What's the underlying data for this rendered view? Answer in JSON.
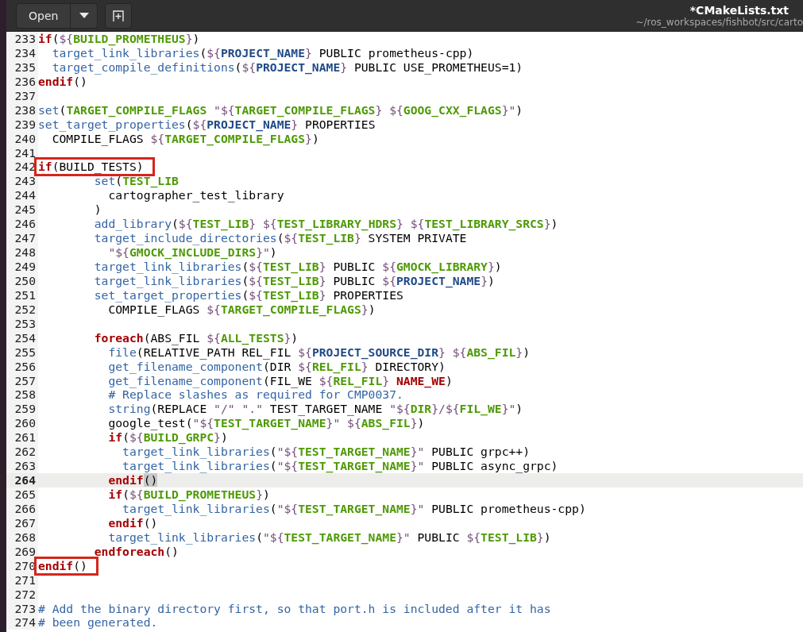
{
  "header": {
    "open_button": "Open",
    "title": "*CMakeLists.txt",
    "subtitle": "~/ros_workspaces/fishbot/src/carto"
  },
  "lines": [
    {
      "number": "233",
      "current": false,
      "boxed": false,
      "tokens": [
        {
          "kind": "kw",
          "text": "if"
        },
        {
          "kind": "txt",
          "text": "("
        },
        {
          "kind": "sym",
          "text": "${"
        },
        {
          "kind": "var",
          "text": "BUILD_PROMETHEUS"
        },
        {
          "kind": "sym",
          "text": "}"
        },
        {
          "kind": "txt",
          "text": ")"
        }
      ]
    },
    {
      "number": "234",
      "current": false,
      "boxed": false,
      "tokens": [
        {
          "kind": "fn",
          "text": "  target_link_libraries"
        },
        {
          "kind": "txt",
          "text": "("
        },
        {
          "kind": "sym",
          "text": "${"
        },
        {
          "kind": "pvar",
          "text": "PROJECT_NAME"
        },
        {
          "kind": "sym",
          "text": "}"
        },
        {
          "kind": "txt",
          "text": " PUBLIC prometheus-cpp)"
        }
      ]
    },
    {
      "number": "235",
      "current": false,
      "boxed": false,
      "tokens": [
        {
          "kind": "fn",
          "text": "  target_compile_definitions"
        },
        {
          "kind": "txt",
          "text": "("
        },
        {
          "kind": "sym",
          "text": "${"
        },
        {
          "kind": "pvar",
          "text": "PROJECT_NAME"
        },
        {
          "kind": "sym",
          "text": "}"
        },
        {
          "kind": "txt",
          "text": " PUBLIC USE_PROMETHEUS=1)"
        }
      ]
    },
    {
      "number": "236",
      "current": false,
      "boxed": false,
      "tokens": [
        {
          "kind": "kw",
          "text": "endif"
        },
        {
          "kind": "txt",
          "text": "()"
        }
      ]
    },
    {
      "number": "237",
      "current": false,
      "boxed": false
    },
    {
      "number": "238",
      "current": false,
      "boxed": false,
      "tokens": [
        {
          "kind": "fn",
          "text": "set"
        },
        {
          "kind": "txt",
          "text": "("
        },
        {
          "kind": "var",
          "text": "TARGET_COMPILE_FLAGS"
        },
        {
          "kind": "sym",
          "text": " \"${"
        },
        {
          "kind": "var",
          "text": "TARGET_COMPILE_FLAGS"
        },
        {
          "kind": "sym",
          "text": "} ${"
        },
        {
          "kind": "var",
          "text": "GOOG_CXX_FLAGS"
        },
        {
          "kind": "sym",
          "text": "}\""
        },
        {
          "kind": "txt",
          "text": ")"
        }
      ]
    },
    {
      "number": "239",
      "current": false,
      "boxed": false,
      "tokens": [
        {
          "kind": "fn",
          "text": "set_target_properties"
        },
        {
          "kind": "txt",
          "text": "("
        },
        {
          "kind": "sym",
          "text": "${"
        },
        {
          "kind": "pvar",
          "text": "PROJECT_NAME"
        },
        {
          "kind": "sym",
          "text": "}"
        },
        {
          "kind": "txt",
          "text": " PROPERTIES"
        }
      ]
    },
    {
      "number": "240",
      "current": false,
      "boxed": false,
      "tokens": [
        {
          "kind": "txt",
          "text": "  COMPILE_FLAGS "
        },
        {
          "kind": "sym",
          "text": "${"
        },
        {
          "kind": "var",
          "text": "TARGET_COMPILE_FLAGS"
        },
        {
          "kind": "sym",
          "text": "}"
        },
        {
          "kind": "txt",
          "text": ")"
        }
      ]
    },
    {
      "number": "241",
      "current": false,
      "boxed": false
    },
    {
      "number": "242",
      "current": false,
      "boxed": true,
      "tokens": [
        {
          "kind": "kw",
          "text": "if"
        },
        {
          "kind": "txt",
          "text": "(BUILD_TESTS)"
        }
      ]
    },
    {
      "number": "243",
      "current": false,
      "boxed": false,
      "tokens": [
        {
          "kind": "fn",
          "text": "        set"
        },
        {
          "kind": "txt",
          "text": "("
        },
        {
          "kind": "var",
          "text": "TEST_LIB"
        }
      ]
    },
    {
      "number": "244",
      "current": false,
      "boxed": false,
      "tokens": [
        {
          "kind": "txt",
          "text": "          cartographer_test_library"
        }
      ]
    },
    {
      "number": "245",
      "current": false,
      "boxed": false,
      "tokens": [
        {
          "kind": "txt",
          "text": "        )"
        }
      ]
    },
    {
      "number": "246",
      "current": false,
      "boxed": false,
      "tokens": [
        {
          "kind": "fn",
          "text": "        add_library"
        },
        {
          "kind": "txt",
          "text": "("
        },
        {
          "kind": "sym",
          "text": "${"
        },
        {
          "kind": "var",
          "text": "TEST_LIB"
        },
        {
          "kind": "sym",
          "text": "} ${"
        },
        {
          "kind": "var",
          "text": "TEST_LIBRARY_HDRS"
        },
        {
          "kind": "sym",
          "text": "} ${"
        },
        {
          "kind": "var",
          "text": "TEST_LIBRARY_SRCS"
        },
        {
          "kind": "sym",
          "text": "}"
        },
        {
          "kind": "txt",
          "text": ")"
        }
      ]
    },
    {
      "number": "247",
      "current": false,
      "boxed": false,
      "tokens": [
        {
          "kind": "fn",
          "text": "        target_include_directories"
        },
        {
          "kind": "txt",
          "text": "("
        },
        {
          "kind": "sym",
          "text": "${"
        },
        {
          "kind": "var",
          "text": "TEST_LIB"
        },
        {
          "kind": "sym",
          "text": "}"
        },
        {
          "kind": "txt",
          "text": " SYSTEM PRIVATE"
        }
      ]
    },
    {
      "number": "248",
      "current": false,
      "boxed": false,
      "tokens": [
        {
          "kind": "sym",
          "text": "          \"${"
        },
        {
          "kind": "var",
          "text": "GMOCK_INCLUDE_DIRS"
        },
        {
          "kind": "sym",
          "text": "}\""
        },
        {
          "kind": "txt",
          "text": ")"
        }
      ]
    },
    {
      "number": "249",
      "current": false,
      "boxed": false,
      "tokens": [
        {
          "kind": "fn",
          "text": "        target_link_libraries"
        },
        {
          "kind": "txt",
          "text": "("
        },
        {
          "kind": "sym",
          "text": "${"
        },
        {
          "kind": "var",
          "text": "TEST_LIB"
        },
        {
          "kind": "sym",
          "text": "}"
        },
        {
          "kind": "txt",
          "text": " PUBLIC "
        },
        {
          "kind": "sym",
          "text": "${"
        },
        {
          "kind": "var",
          "text": "GMOCK_LIBRARY"
        },
        {
          "kind": "sym",
          "text": "}"
        },
        {
          "kind": "txt",
          "text": ")"
        }
      ]
    },
    {
      "number": "250",
      "current": false,
      "boxed": false,
      "tokens": [
        {
          "kind": "fn",
          "text": "        target_link_libraries"
        },
        {
          "kind": "txt",
          "text": "("
        },
        {
          "kind": "sym",
          "text": "${"
        },
        {
          "kind": "var",
          "text": "TEST_LIB"
        },
        {
          "kind": "sym",
          "text": "}"
        },
        {
          "kind": "txt",
          "text": " PUBLIC "
        },
        {
          "kind": "sym",
          "text": "${"
        },
        {
          "kind": "pvar",
          "text": "PROJECT_NAME"
        },
        {
          "kind": "sym",
          "text": "}"
        },
        {
          "kind": "txt",
          "text": ")"
        }
      ]
    },
    {
      "number": "251",
      "current": false,
      "boxed": false,
      "tokens": [
        {
          "kind": "fn",
          "text": "        set_target_properties"
        },
        {
          "kind": "txt",
          "text": "("
        },
        {
          "kind": "sym",
          "text": "${"
        },
        {
          "kind": "var",
          "text": "TEST_LIB"
        },
        {
          "kind": "sym",
          "text": "}"
        },
        {
          "kind": "txt",
          "text": " PROPERTIES"
        }
      ]
    },
    {
      "number": "252",
      "current": false,
      "boxed": false,
      "tokens": [
        {
          "kind": "txt",
          "text": "          COMPILE_FLAGS "
        },
        {
          "kind": "sym",
          "text": "${"
        },
        {
          "kind": "var",
          "text": "TARGET_COMPILE_FLAGS"
        },
        {
          "kind": "sym",
          "text": "}"
        },
        {
          "kind": "txt",
          "text": ")"
        }
      ]
    },
    {
      "number": "253",
      "current": false,
      "boxed": false
    },
    {
      "number": "254",
      "current": false,
      "boxed": false,
      "tokens": [
        {
          "kind": "kw",
          "text": "        foreach"
        },
        {
          "kind": "txt",
          "text": "(ABS_FIL "
        },
        {
          "kind": "sym",
          "text": "${"
        },
        {
          "kind": "var",
          "text": "ALL_TESTS"
        },
        {
          "kind": "sym",
          "text": "}"
        },
        {
          "kind": "txt",
          "text": ")"
        }
      ]
    },
    {
      "number": "255",
      "current": false,
      "boxed": false,
      "tokens": [
        {
          "kind": "fn",
          "text": "          file"
        },
        {
          "kind": "txt",
          "text": "(RELATIVE_PATH REL_FIL "
        },
        {
          "kind": "sym",
          "text": "${"
        },
        {
          "kind": "pvar",
          "text": "PROJECT_SOURCE_DIR"
        },
        {
          "kind": "sym",
          "text": "} ${"
        },
        {
          "kind": "var",
          "text": "ABS_FIL"
        },
        {
          "kind": "sym",
          "text": "}"
        },
        {
          "kind": "txt",
          "text": ")"
        }
      ]
    },
    {
      "number": "256",
      "current": false,
      "boxed": false,
      "tokens": [
        {
          "kind": "fn",
          "text": "          get_filename_component"
        },
        {
          "kind": "txt",
          "text": "(DIR "
        },
        {
          "kind": "sym",
          "text": "${"
        },
        {
          "kind": "var",
          "text": "REL_FIL"
        },
        {
          "kind": "sym",
          "text": "}"
        },
        {
          "kind": "txt",
          "text": " DIRECTORY)"
        }
      ]
    },
    {
      "number": "257",
      "current": false,
      "boxed": false,
      "tokens": [
        {
          "kind": "fn",
          "text": "          get_filename_component"
        },
        {
          "kind": "txt",
          "text": "(FIL_WE "
        },
        {
          "kind": "sym",
          "text": "${"
        },
        {
          "kind": "var",
          "text": "REL_FIL"
        },
        {
          "kind": "sym",
          "text": "} "
        },
        {
          "kind": "const",
          "text": "NAME_WE"
        },
        {
          "kind": "txt",
          "text": ")"
        }
      ]
    },
    {
      "number": "258",
      "current": false,
      "boxed": false,
      "tokens": [
        {
          "kind": "cmt",
          "text": "          # Replace slashes as required for CMP0037."
        }
      ]
    },
    {
      "number": "259",
      "current": false,
      "boxed": false,
      "tokens": [
        {
          "kind": "fn",
          "text": "          string"
        },
        {
          "kind": "txt",
          "text": "(REPLACE "
        },
        {
          "kind": "sym",
          "text": "\"/\" \".\""
        },
        {
          "kind": "txt",
          "text": " TEST_TARGET_NAME "
        },
        {
          "kind": "sym",
          "text": "\"${"
        },
        {
          "kind": "var",
          "text": "DIR"
        },
        {
          "kind": "sym",
          "text": "}/${"
        },
        {
          "kind": "var",
          "text": "FIL_WE"
        },
        {
          "kind": "sym",
          "text": "}\""
        },
        {
          "kind": "txt",
          "text": ")"
        }
      ]
    },
    {
      "number": "260",
      "current": false,
      "boxed": false,
      "tokens": [
        {
          "kind": "txt",
          "text": "          google_test("
        },
        {
          "kind": "sym",
          "text": "\"${"
        },
        {
          "kind": "var",
          "text": "TEST_TARGET_NAME"
        },
        {
          "kind": "sym",
          "text": "}\" ${"
        },
        {
          "kind": "var",
          "text": "ABS_FIL"
        },
        {
          "kind": "sym",
          "text": "}"
        },
        {
          "kind": "txt",
          "text": ")"
        }
      ]
    },
    {
      "number": "261",
      "current": false,
      "boxed": false,
      "tokens": [
        {
          "kind": "kw",
          "text": "          if"
        },
        {
          "kind": "txt",
          "text": "("
        },
        {
          "kind": "sym",
          "text": "${"
        },
        {
          "kind": "var",
          "text": "BUILD_GRPC"
        },
        {
          "kind": "sym",
          "text": "}"
        },
        {
          "kind": "txt",
          "text": ")"
        }
      ]
    },
    {
      "number": "262",
      "current": false,
      "boxed": false,
      "tokens": [
        {
          "kind": "fn",
          "text": "            target_link_libraries"
        },
        {
          "kind": "txt",
          "text": "("
        },
        {
          "kind": "sym",
          "text": "\"${"
        },
        {
          "kind": "var",
          "text": "TEST_TARGET_NAME"
        },
        {
          "kind": "sym",
          "text": "}\""
        },
        {
          "kind": "txt",
          "text": " PUBLIC grpc++)"
        }
      ]
    },
    {
      "number": "263",
      "current": false,
      "boxed": false,
      "tokens": [
        {
          "kind": "fn",
          "text": "            target_link_libraries"
        },
        {
          "kind": "txt",
          "text": "("
        },
        {
          "kind": "sym",
          "text": "\"${"
        },
        {
          "kind": "var",
          "text": "TEST_TARGET_NAME"
        },
        {
          "kind": "sym",
          "text": "}\""
        },
        {
          "kind": "txt",
          "text": " PUBLIC async_grpc)"
        }
      ]
    },
    {
      "number": "264",
      "current": true,
      "boxed": false,
      "tokens": [
        {
          "kind": "kw",
          "text": "          endif"
        },
        {
          "kind": "match",
          "text": "()"
        }
      ]
    },
    {
      "number": "265",
      "current": false,
      "boxed": false,
      "tokens": [
        {
          "kind": "kw",
          "text": "          if"
        },
        {
          "kind": "txt",
          "text": "("
        },
        {
          "kind": "sym",
          "text": "${"
        },
        {
          "kind": "var",
          "text": "BUILD_PROMETHEUS"
        },
        {
          "kind": "sym",
          "text": "}"
        },
        {
          "kind": "txt",
          "text": ")"
        }
      ]
    },
    {
      "number": "266",
      "current": false,
      "boxed": false,
      "tokens": [
        {
          "kind": "fn",
          "text": "            target_link_libraries"
        },
        {
          "kind": "txt",
          "text": "("
        },
        {
          "kind": "sym",
          "text": "\"${"
        },
        {
          "kind": "var",
          "text": "TEST_TARGET_NAME"
        },
        {
          "kind": "sym",
          "text": "}\""
        },
        {
          "kind": "txt",
          "text": " PUBLIC prometheus-cpp)"
        }
      ]
    },
    {
      "number": "267",
      "current": false,
      "boxed": false,
      "tokens": [
        {
          "kind": "kw",
          "text": "          endif"
        },
        {
          "kind": "txt",
          "text": "()"
        }
      ]
    },
    {
      "number": "268",
      "current": false,
      "boxed": false,
      "tokens": [
        {
          "kind": "fn",
          "text": "          target_link_libraries"
        },
        {
          "kind": "txt",
          "text": "("
        },
        {
          "kind": "sym",
          "text": "\"${"
        },
        {
          "kind": "var",
          "text": "TEST_TARGET_NAME"
        },
        {
          "kind": "sym",
          "text": "}\""
        },
        {
          "kind": "txt",
          "text": " PUBLIC "
        },
        {
          "kind": "sym",
          "text": "${"
        },
        {
          "kind": "var",
          "text": "TEST_LIB"
        },
        {
          "kind": "sym",
          "text": "}"
        },
        {
          "kind": "txt",
          "text": ")"
        }
      ]
    },
    {
      "number": "269",
      "current": false,
      "boxed": false,
      "tokens": [
        {
          "kind": "kw",
          "text": "        endforeach"
        },
        {
          "kind": "txt",
          "text": "()"
        }
      ]
    },
    {
      "number": "270",
      "current": false,
      "boxed": true,
      "tokens": [
        {
          "kind": "kw",
          "text": "endif"
        },
        {
          "kind": "txt",
          "text": "()"
        }
      ]
    },
    {
      "number": "271",
      "current": false,
      "boxed": false
    },
    {
      "number": "272",
      "current": false,
      "boxed": false
    },
    {
      "number": "273",
      "current": false,
      "boxed": false,
      "tokens": [
        {
          "kind": "cmt",
          "text": "# Add the binary directory first, so that port.h is included after it has"
        }
      ]
    },
    {
      "number": "274",
      "current": false,
      "boxed": false,
      "tokens": [
        {
          "kind": "cmt",
          "text": "# been generated."
        }
      ]
    }
  ]
}
